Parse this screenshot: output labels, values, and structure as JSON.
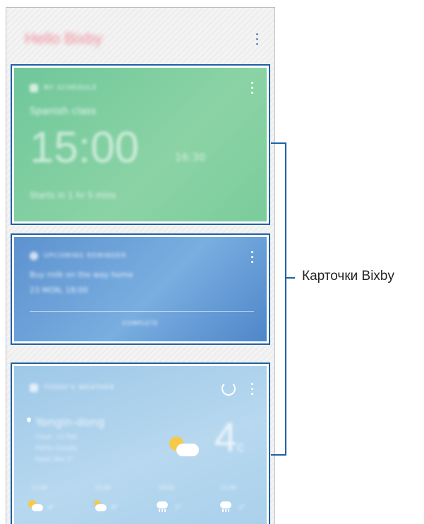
{
  "app": {
    "title": "Hello Bixby"
  },
  "cards": {
    "schedule": {
      "label": "MY SCHEDULE",
      "title": "Spanish class",
      "time": "15:00",
      "end_time": "16:30",
      "footer": "Starts in 1 hr 5 mins"
    },
    "reminder": {
      "label": "UPCOMING REMINDER",
      "text": "Buy milk on the way home",
      "date": "23 MON, 18:00",
      "action": "COMPLETE"
    },
    "weather": {
      "label": "TODAY'S WEATHER",
      "location": "Yongin-dong",
      "details": [
        "Clear, 15 Feb",
        "Partly Cloudy",
        "Feels like 2°"
      ],
      "temperature": "4",
      "unit": "c",
      "forecast_times": [
        "12:00",
        "15:00",
        "18:00",
        "21:00"
      ],
      "forecast_temps": [
        "4°",
        "6°",
        "1°",
        "2°"
      ]
    }
  },
  "callout": {
    "label": "Карточки Bixby"
  },
  "colors": {
    "highlight": "#1f5fa6",
    "schedule_card": "#7bcc9b",
    "reminder_card": "#5d92cf",
    "weather_card": "#a9d0ec"
  },
  "icons": {
    "header_menu": "more-vert-icon",
    "schedule": "calendar-icon",
    "reminder": "bell-icon",
    "weather": "weather-icon",
    "refresh": "refresh-icon",
    "location": "pin-icon"
  }
}
